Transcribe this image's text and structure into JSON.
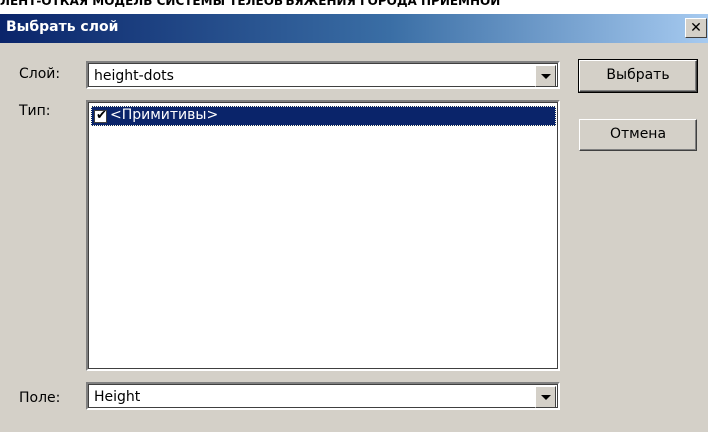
{
  "background_text": "ЛЕНТ-ОТКАЯ МОДЕЛЬ СИСТЕМЫ ТЕЛЕОБЪЯЖЕНИЯ ГОРОДА ПРИЕМНОЙ",
  "dialog": {
    "title": "Выбрать слой",
    "close_glyph": "✕"
  },
  "layer": {
    "label": "Слой:",
    "value": "height-dots"
  },
  "type": {
    "label": "Тип:",
    "items": [
      {
        "label": "<Примитивы>",
        "checked": true,
        "selected": true
      }
    ]
  },
  "field": {
    "label": "Поле:",
    "value": "Height"
  },
  "buttons": {
    "ok": "Выбрать",
    "cancel": "Отмена"
  },
  "colors": {
    "title_bar_start": "#0a246a",
    "dialog_face": "#d4d0c8",
    "selection": "#0a246a"
  }
}
